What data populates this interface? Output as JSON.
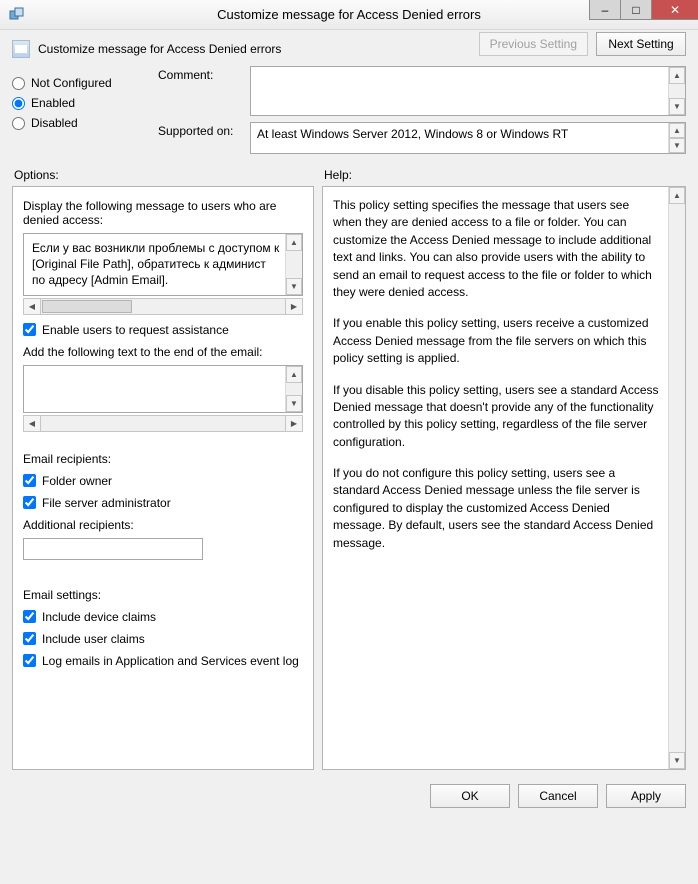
{
  "window": {
    "title": "Customize message for Access Denied errors",
    "minimize": "–",
    "maximize": "□",
    "close": "✕"
  },
  "subheader": {
    "title": "Customize message for Access Denied errors"
  },
  "nav": {
    "previous": "Previous Setting",
    "next": "Next Setting"
  },
  "state": {
    "not_configured": "Not Configured",
    "enabled": "Enabled",
    "disabled": "Disabled",
    "selected": "enabled"
  },
  "form": {
    "comment_label": "Comment:",
    "comment_value": "",
    "supported_label": "Supported on:",
    "supported_value": "At least Windows Server 2012, Windows 8 or Windows RT"
  },
  "panes": {
    "options_label": "Options:",
    "help_label": "Help:"
  },
  "options": {
    "display_msg_label": "Display the following message to users who are denied access:",
    "display_msg_value": "Если у вас возникли проблемы с доступом к [Original File Path], обратитесь к админист по адресу [Admin Email].",
    "enable_request": "Enable users to request assistance",
    "append_email_label": "Add the following text to the end of the email:",
    "append_email_value": "",
    "recipients_label": "Email recipients:",
    "folder_owner": "Folder owner",
    "fs_admin": "File server administrator",
    "additional_recipients_label": "Additional recipients:",
    "additional_recipients_value": "",
    "settings_label": "Email settings:",
    "include_device": "Include device claims",
    "include_user": "Include user claims",
    "log_emails": "Log emails in Application and Services event log",
    "checks": {
      "enable_request": true,
      "folder_owner": true,
      "fs_admin": true,
      "include_device": true,
      "include_user": true,
      "log_emails": true
    }
  },
  "help": {
    "p1": "This policy setting specifies the message that users see when they are denied access to a file or folder. You can customize the Access Denied message to include additional text and links. You can also provide users with the ability to send an email to request access to the file or folder to which they were denied access.",
    "p2": "If you enable this policy setting, users receive a customized Access Denied message from the file servers on which this policy setting is applied.",
    "p3": "If you disable this policy setting, users see a standard Access Denied message that doesn't provide any of the functionality controlled by this policy setting, regardless of the file server configuration.",
    "p4": "If you do not configure this policy setting, users see a standard Access Denied message unless the file server is configured to display the customized Access Denied message. By default, users see the standard Access Denied message."
  },
  "footer": {
    "ok": "OK",
    "cancel": "Cancel",
    "apply": "Apply"
  }
}
